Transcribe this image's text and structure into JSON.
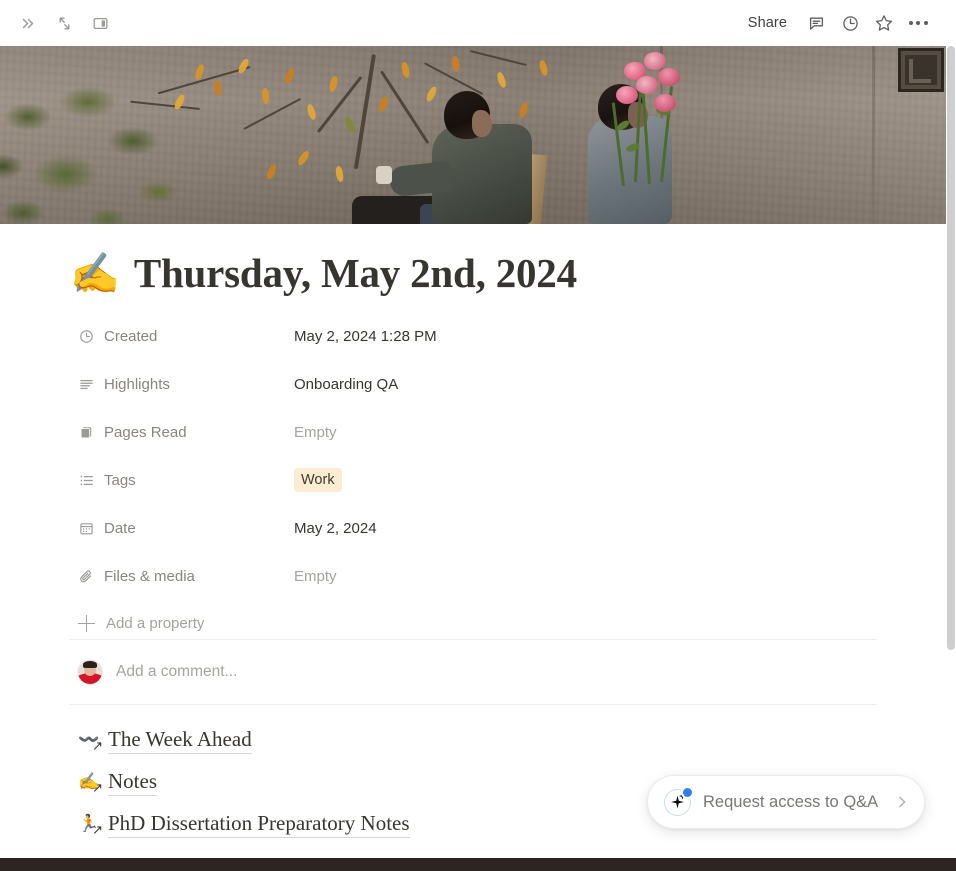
{
  "topbar": {
    "left_icons": [
      {
        "name": "expand-sidebar-icon",
        "glyph": "»"
      },
      {
        "name": "collapse-arrows-icon",
        "glyph": "↘"
      },
      {
        "name": "sidebar-panel-icon",
        "glyph": "▣"
      }
    ],
    "share_label": "Share",
    "right_icons": [
      {
        "name": "comment-icon"
      },
      {
        "name": "clock-history-icon"
      },
      {
        "name": "star-favorite-icon"
      },
      {
        "name": "more-options-icon"
      }
    ]
  },
  "cover": {
    "alt": "Two men riding a motorcycle carrying flowers beside a concrete wall with an autumn tree"
  },
  "title": {
    "emoji": "✍️",
    "text": "Thursday, May 2nd, 2024"
  },
  "properties": [
    {
      "icon": "clock-icon",
      "label": "Created",
      "value": "May 2, 2024 1:28 PM",
      "empty": false,
      "type": "text"
    },
    {
      "icon": "text-lines-icon",
      "label": "Highlights",
      "value": "Onboarding QA",
      "empty": false,
      "type": "text"
    },
    {
      "icon": "book-icon",
      "label": "Pages Read",
      "value": "Empty",
      "empty": true,
      "type": "text"
    },
    {
      "icon": "list-icon",
      "label": "Tags",
      "value": "Work",
      "empty": false,
      "type": "tag"
    },
    {
      "icon": "calendar-icon",
      "label": "Date",
      "value": "May 2, 2024",
      "empty": false,
      "type": "text"
    },
    {
      "icon": "paperclip-icon",
      "label": "Files & media",
      "value": "Empty",
      "empty": true,
      "type": "text"
    }
  ],
  "add_property_label": "Add a property",
  "comment": {
    "placeholder": "Add a comment..."
  },
  "page_links": [
    {
      "emoji": "〰️",
      "label": "The Week Ahead"
    },
    {
      "emoji": "✍️",
      "label": "Notes"
    },
    {
      "emoji": "🏃",
      "label": "PhD Dissertation Preparatory Notes"
    }
  ],
  "qa_pill": {
    "label": "Request access to Q&A",
    "icon": "ai-sparkle-icon",
    "chevron": "chevron-right-icon",
    "dot_color": "#2e7ff0"
  },
  "colors": {
    "tag_work_bg": "#fbecd2",
    "text_primary": "#37352f",
    "text_muted": "#88857f",
    "text_empty": "#a5a39e",
    "divider": "#ececeb",
    "scrollbar_thumb": "#cfcfcd",
    "bottom_bar": "#2d2522"
  }
}
